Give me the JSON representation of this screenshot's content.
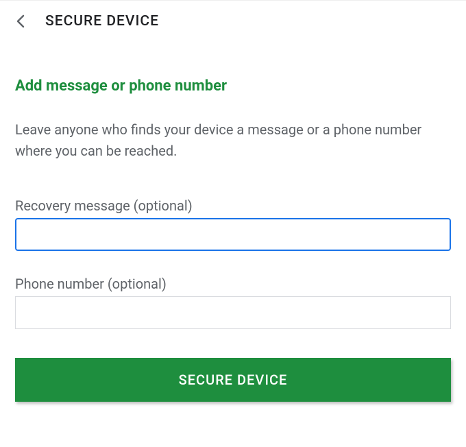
{
  "header": {
    "title": "SECURE DEVICE"
  },
  "section": {
    "title": "Add message or phone number",
    "description": "Leave anyone who finds your device a message or a phone number where you can be reached."
  },
  "fields": {
    "recovery_message": {
      "label": "Recovery message (optional)",
      "value": ""
    },
    "phone_number": {
      "label": "Phone number (optional)",
      "value": ""
    }
  },
  "actions": {
    "secure_button": "SECURE DEVICE"
  },
  "colors": {
    "accent": "#1e8e3e",
    "focus": "#1a73e8",
    "text_secondary": "#5f6368"
  }
}
